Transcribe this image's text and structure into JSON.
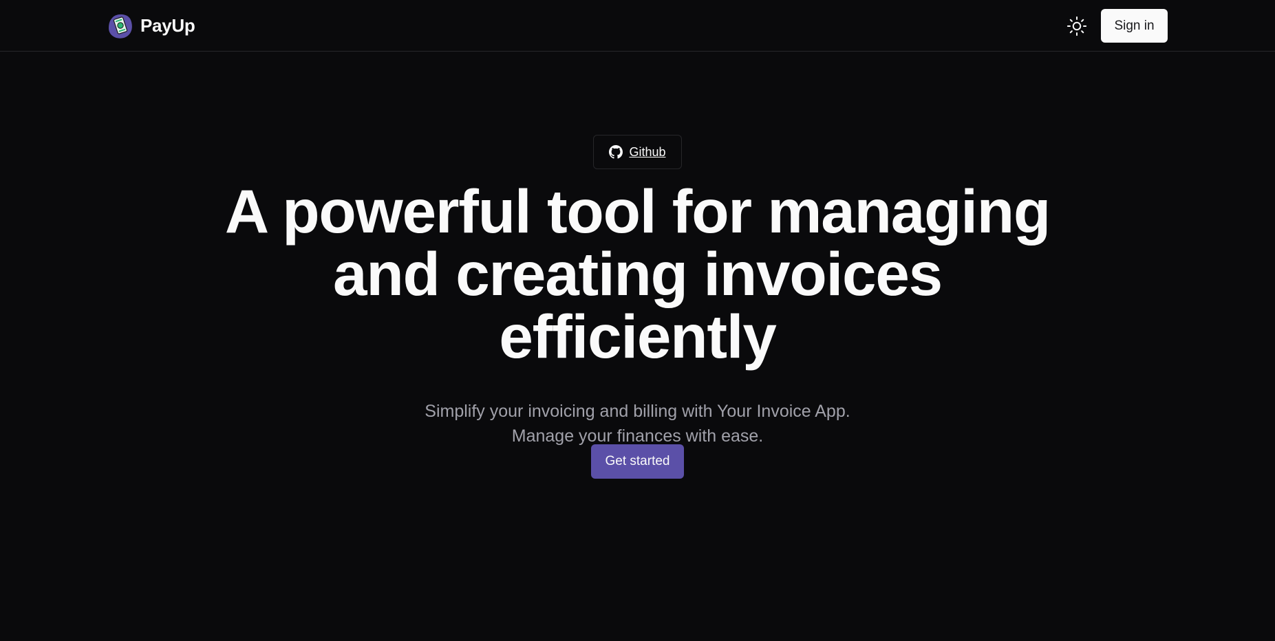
{
  "header": {
    "brand_name": "PayUp",
    "logo_icon": "payup-logo-icon",
    "theme_toggle_icon": "sun-icon",
    "signin_label": "Sign in"
  },
  "hero": {
    "github_label": "Github",
    "github_icon": "github-icon",
    "title_lines": [
      "A powerful tool for managing",
      "and creating invoices",
      "efficiently"
    ],
    "subtitle_lines": [
      "Simplify your invoicing and billing with Your Invoice App.",
      "Manage your finances with ease."
    ],
    "cta_label": "Get started"
  },
  "colors": {
    "background": "#0a0a0c",
    "foreground": "#fafafa",
    "muted": "#a1a1aa",
    "accent": "#5b50a8",
    "border": "#27272a"
  }
}
